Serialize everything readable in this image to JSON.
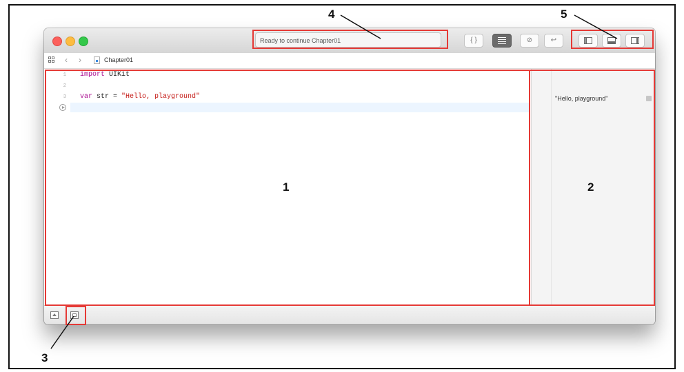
{
  "window": {
    "status_text": "Ready to continue Chapter01",
    "toolbar": {
      "standard_editor": "{ }",
      "assistant_editor": "⊘",
      "version_editor": "↩"
    }
  },
  "jumpbar": {
    "file_label": "Chapter01"
  },
  "editor": {
    "lines": [
      {
        "num": "1",
        "kw": "import",
        "rest": " UIKit"
      },
      {
        "num": "2"
      },
      {
        "num": "3",
        "kw": "var",
        "rest": " str = ",
        "str": "\"Hello, playground\""
      }
    ]
  },
  "results": {
    "line3": "\"Hello, playground\""
  },
  "callouts": {
    "c1": "1",
    "c2": "2",
    "c3": "3",
    "c4": "4",
    "c5": "5"
  },
  "colors": {
    "annotation": "#e53935",
    "keyword": "#aa0d91",
    "string": "#c41a16"
  }
}
